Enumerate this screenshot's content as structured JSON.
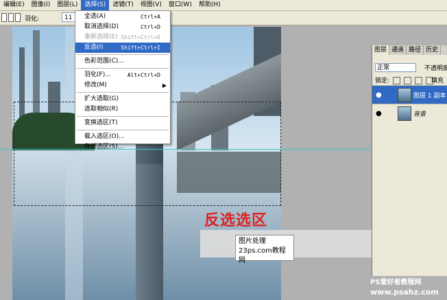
{
  "menubar": {
    "items": [
      {
        "label": "编辑(E)"
      },
      {
        "label": "图像(I)"
      },
      {
        "label": "图层(L)"
      },
      {
        "label": "选择(S)"
      },
      {
        "label": "滤镜(T)"
      },
      {
        "label": "视图(V)"
      },
      {
        "label": "窗口(W)"
      },
      {
        "label": "帮助(H)"
      }
    ]
  },
  "options": {
    "feather_label": "羽化:",
    "feather_value": "11"
  },
  "select_menu": {
    "items": [
      {
        "label": "全选(A)",
        "shortcut": "Ctrl+A"
      },
      {
        "label": "取消选择(D)",
        "shortcut": "Ctrl+D"
      },
      {
        "label": "重新选择(E)",
        "shortcut": "Shift+Ctrl+D"
      },
      {
        "label": "反选(I)",
        "shortcut": "Shift+Ctrl+I"
      },
      {
        "label": "色彩范围(C)..."
      },
      {
        "label": "羽化(F)...",
        "shortcut": "Alt+Ctrl+D"
      },
      {
        "label": "修改(M)"
      },
      {
        "label": "扩大选取(G)"
      },
      {
        "label": "选取相似(R)"
      },
      {
        "label": "变换选区(T)"
      },
      {
        "label": "载入选区(O)..."
      },
      {
        "label": "存储选区(S)..."
      }
    ]
  },
  "layers_panel": {
    "tabs": [
      "图层",
      "通道",
      "路径",
      "历史"
    ],
    "blend_mode": "正常",
    "opacity_label": "不透明度",
    "lock_label": "锁定:",
    "fill_label": "填充",
    "layers": [
      {
        "name": "图层 1 副本"
      },
      {
        "name": "背景"
      }
    ]
  },
  "canvas": {
    "caption": "反选选区",
    "watermark_line1": "图片处理",
    "watermark_line2": "23ps.com教程网"
  },
  "footer": {
    "site_name": "PS爱好者教程网",
    "site_url": "www.psahz.com"
  }
}
